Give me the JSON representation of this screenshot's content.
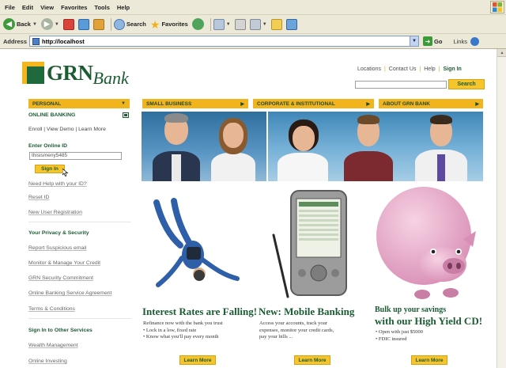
{
  "browser": {
    "menu": [
      "File",
      "Edit",
      "View",
      "Favorites",
      "Tools",
      "Help"
    ],
    "toolbar": {
      "back_label": "Back",
      "search_label": "Search",
      "favorites_label": "Favorites"
    },
    "address": {
      "label": "Address",
      "url": "http://localhost",
      "go_label": "Go",
      "links_label": "Links"
    }
  },
  "site": {
    "logo": {
      "brand": "GRN",
      "bank": "Bank"
    },
    "header_links": {
      "locations": "Locations",
      "contact": "Contact Us",
      "help": "Help",
      "sign_in": "Sign In"
    },
    "search_button": "Search",
    "nav": {
      "personal": "PERSONAL",
      "small_business": "SMALL BUSINESS",
      "corporate": "CORPORATE & INSTITUTIONAL",
      "about": "ABOUT GRN BANK"
    },
    "sidebar": {
      "online_banking": "ONLINE BANKING",
      "enroll_links": "Enroll | View Demo | Learn More",
      "enter_online_id": "Enter Online ID",
      "online_id_value": "thisismeny5485",
      "sign_in_button": "Sign In",
      "need_help": "Need Help with your ID?",
      "reset_id": "Reset ID",
      "new_user": "New User Registration",
      "privacy_heading": "Your Privacy & Security",
      "report_email": "Report Suspicious email",
      "monitor_credit": "Monitor & Manage Your Credit",
      "security_commitment": "GRN Security Commitment",
      "service_agreement": "Online Banking Service Agreement",
      "terms": "Terms & Conditions",
      "other_services_heading": "Sign In to Other Services",
      "wealth": "Wealth Management",
      "investing": "Online Investing"
    },
    "promos": [
      {
        "title": "Interest Rates are Falling!",
        "line1": "Refinance now with the bank you trust",
        "line2": "• Lock in a low, fixed rate",
        "line3": "• Know what you'll pay every month",
        "button": "Learn More"
      },
      {
        "title": "New: Mobile Banking",
        "line1": "Access your accounts, track your",
        "line2": "expenses, monitor your credit cards,",
        "line3": "pay your bills ...",
        "button": "Learn More"
      },
      {
        "title": "Bulk up your savings",
        "title2": "with our High Yield CD!",
        "line1": "• Open with just $5000",
        "line2": "• FDIC insured",
        "button": "Learn More"
      }
    ]
  },
  "colors": {
    "brand_green": "#1b5c33",
    "brand_gold": "#f2b41d",
    "chrome": "#ece9d8"
  }
}
